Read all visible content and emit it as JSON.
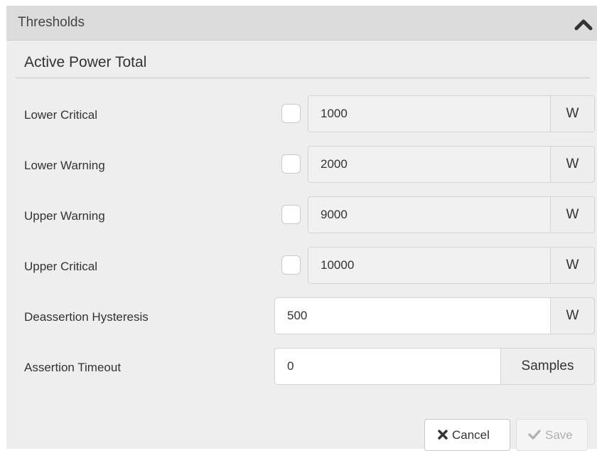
{
  "panel": {
    "title": "Thresholds",
    "collapse_icon": "chevron-up-icon"
  },
  "section": {
    "title": "Active Power Total"
  },
  "thresholds": [
    {
      "label": "Lower Critical",
      "enabled": false,
      "value": "1000",
      "unit": "W"
    },
    {
      "label": "Lower Warning",
      "enabled": false,
      "value": "2000",
      "unit": "W"
    },
    {
      "label": "Upper Warning",
      "enabled": false,
      "value": "9000",
      "unit": "W"
    },
    {
      "label": "Upper Critical",
      "enabled": false,
      "value": "10000",
      "unit": "W"
    }
  ],
  "hysteresis": {
    "label": "Deassertion Hysteresis",
    "value": "500",
    "unit": "W"
  },
  "timeout": {
    "label": "Assertion Timeout",
    "value": "0",
    "unit": "Samples"
  },
  "actions": {
    "cancel_label": "Cancel",
    "cancel_icon": "x-icon",
    "save_label": "Save",
    "save_icon": "check-icon",
    "save_enabled": false
  }
}
